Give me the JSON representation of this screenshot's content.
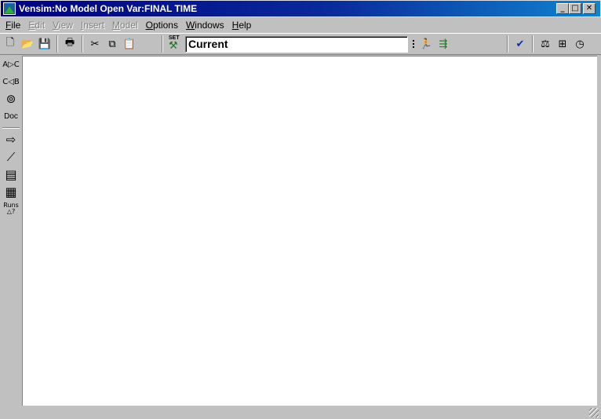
{
  "window": {
    "title": "Vensim:No Model Open Var:FINAL TIME",
    "minimize_glyph": "_",
    "maximize_glyph": "□",
    "close_glyph": "✕"
  },
  "menu": [
    {
      "label": "File",
      "disabled": false
    },
    {
      "label": "Edit",
      "disabled": true
    },
    {
      "label": "View",
      "disabled": true
    },
    {
      "label": "Insert",
      "disabled": true
    },
    {
      "label": "Model",
      "disabled": true
    },
    {
      "label": "Options",
      "disabled": false
    },
    {
      "label": "Windows",
      "disabled": false
    },
    {
      "label": "Help",
      "disabled": false
    }
  ],
  "toolbar": {
    "new_glyph": "🗋",
    "open_glyph": "📂",
    "save_glyph": "💾",
    "print_glyph": "🖶",
    "cut_glyph": "✂",
    "copy_glyph": "⧉",
    "paste_glyph": "📋",
    "set_label": "SET",
    "set_glyph": "⚒",
    "run_name": "Current",
    "simulate_glyph": "🏃",
    "simulate_game_glyph": "⇶",
    "check_model_glyph": "✔",
    "reality_check_glyph": "⚖",
    "sensitivity_glyph": "⊞",
    "clock_glyph": "◷"
  },
  "sidebar": {
    "causes_tree_label": "A▷C",
    "uses_tree_label": "C◁B",
    "loops_glyph": "⊚",
    "doc_label": "Doc",
    "causes_strip_glyph": "⇨",
    "graph_glyph": "⟋",
    "table_glyph": "▤",
    "table_time_glyph": "▦",
    "runs_compare_label": "Runs △?"
  }
}
